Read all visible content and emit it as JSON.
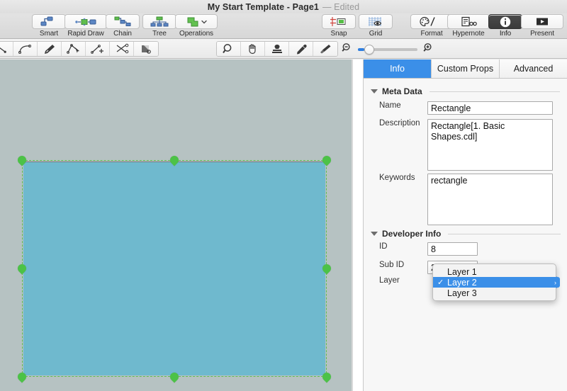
{
  "window": {
    "title": "My Start Template - Page1",
    "edited_label": "— Edited"
  },
  "toolbar": {
    "left_group": [
      {
        "label": "Smart",
        "icon": "smart-connector-icon"
      },
      {
        "label": "Rapid Draw",
        "icon": "rapid-draw-icon"
      },
      {
        "label": "Chain",
        "icon": "chain-icon"
      },
      {
        "label": "Tree",
        "icon": "tree-icon"
      },
      {
        "label": "Operations",
        "icon": "operations-shape-icon"
      }
    ],
    "middle_group": [
      {
        "label": "Snap",
        "icon": "snap-icon"
      },
      {
        "label": "Grid",
        "icon": "grid-eye-icon"
      }
    ],
    "right_group": [
      {
        "label": "Format",
        "icon": "palette-icon",
        "selected": false
      },
      {
        "label": "Hypernote",
        "icon": "hypernote-icon",
        "selected": false
      },
      {
        "label": "Info",
        "icon": "info-circle-icon",
        "selected": true
      },
      {
        "label": "Present",
        "icon": "present-play-icon",
        "selected": false
      }
    ]
  },
  "toolbar2": {
    "draw_tools": [
      {
        "icon": "line-tool-icon"
      },
      {
        "icon": "arc-tool-icon"
      },
      {
        "icon": "pen-tool-icon"
      },
      {
        "icon": "node-edit-tool-icon"
      },
      {
        "icon": "add-node-tool-icon"
      },
      {
        "icon": "cut-path-tool-icon"
      },
      {
        "icon": "shape-stamp-tool-icon"
      }
    ],
    "view_tools": [
      {
        "icon": "magnifier-icon"
      },
      {
        "icon": "hand-pan-icon"
      },
      {
        "icon": "stamp-icon"
      },
      {
        "icon": "eyedropper-icon"
      },
      {
        "icon": "paintbrush-icon"
      }
    ],
    "zoom": {
      "out_icon": "zoom-out-icon",
      "in_icon": "zoom-in-icon",
      "value_percent": 10
    }
  },
  "canvas": {
    "selected_shape": "rectangle",
    "fill_color": "#6fb9ce",
    "selection_color": "#5dbf4f",
    "background_color": "#b6c2c2",
    "rotate_handle_icon": "rotate-handle-icon"
  },
  "inspector": {
    "tabs": [
      {
        "label": "Info",
        "active": true
      },
      {
        "label": "Custom Props",
        "active": false
      },
      {
        "label": "Advanced",
        "active": false
      }
    ],
    "meta_data": {
      "section_label": "Meta Data",
      "name_label": "Name",
      "name_value": "Rectangle",
      "description_label": "Description",
      "description_value": "Rectangle[1. Basic Shapes.cdl]",
      "keywords_label": "Keywords",
      "keywords_value": "rectangle"
    },
    "developer_info": {
      "section_label": "Developer Info",
      "id_label": "ID",
      "id_value": "8",
      "sub_id_label": "Sub ID",
      "sub_id_value": "27824",
      "layer_label": "Layer",
      "layer_value": "Layer 2"
    },
    "layer_dropdown": {
      "open": true,
      "options": [
        {
          "label": "Layer 1",
          "checked": false
        },
        {
          "label": "Layer 2",
          "checked": true
        },
        {
          "label": "Layer 3",
          "checked": false
        }
      ],
      "check_glyph": "✓"
    }
  }
}
